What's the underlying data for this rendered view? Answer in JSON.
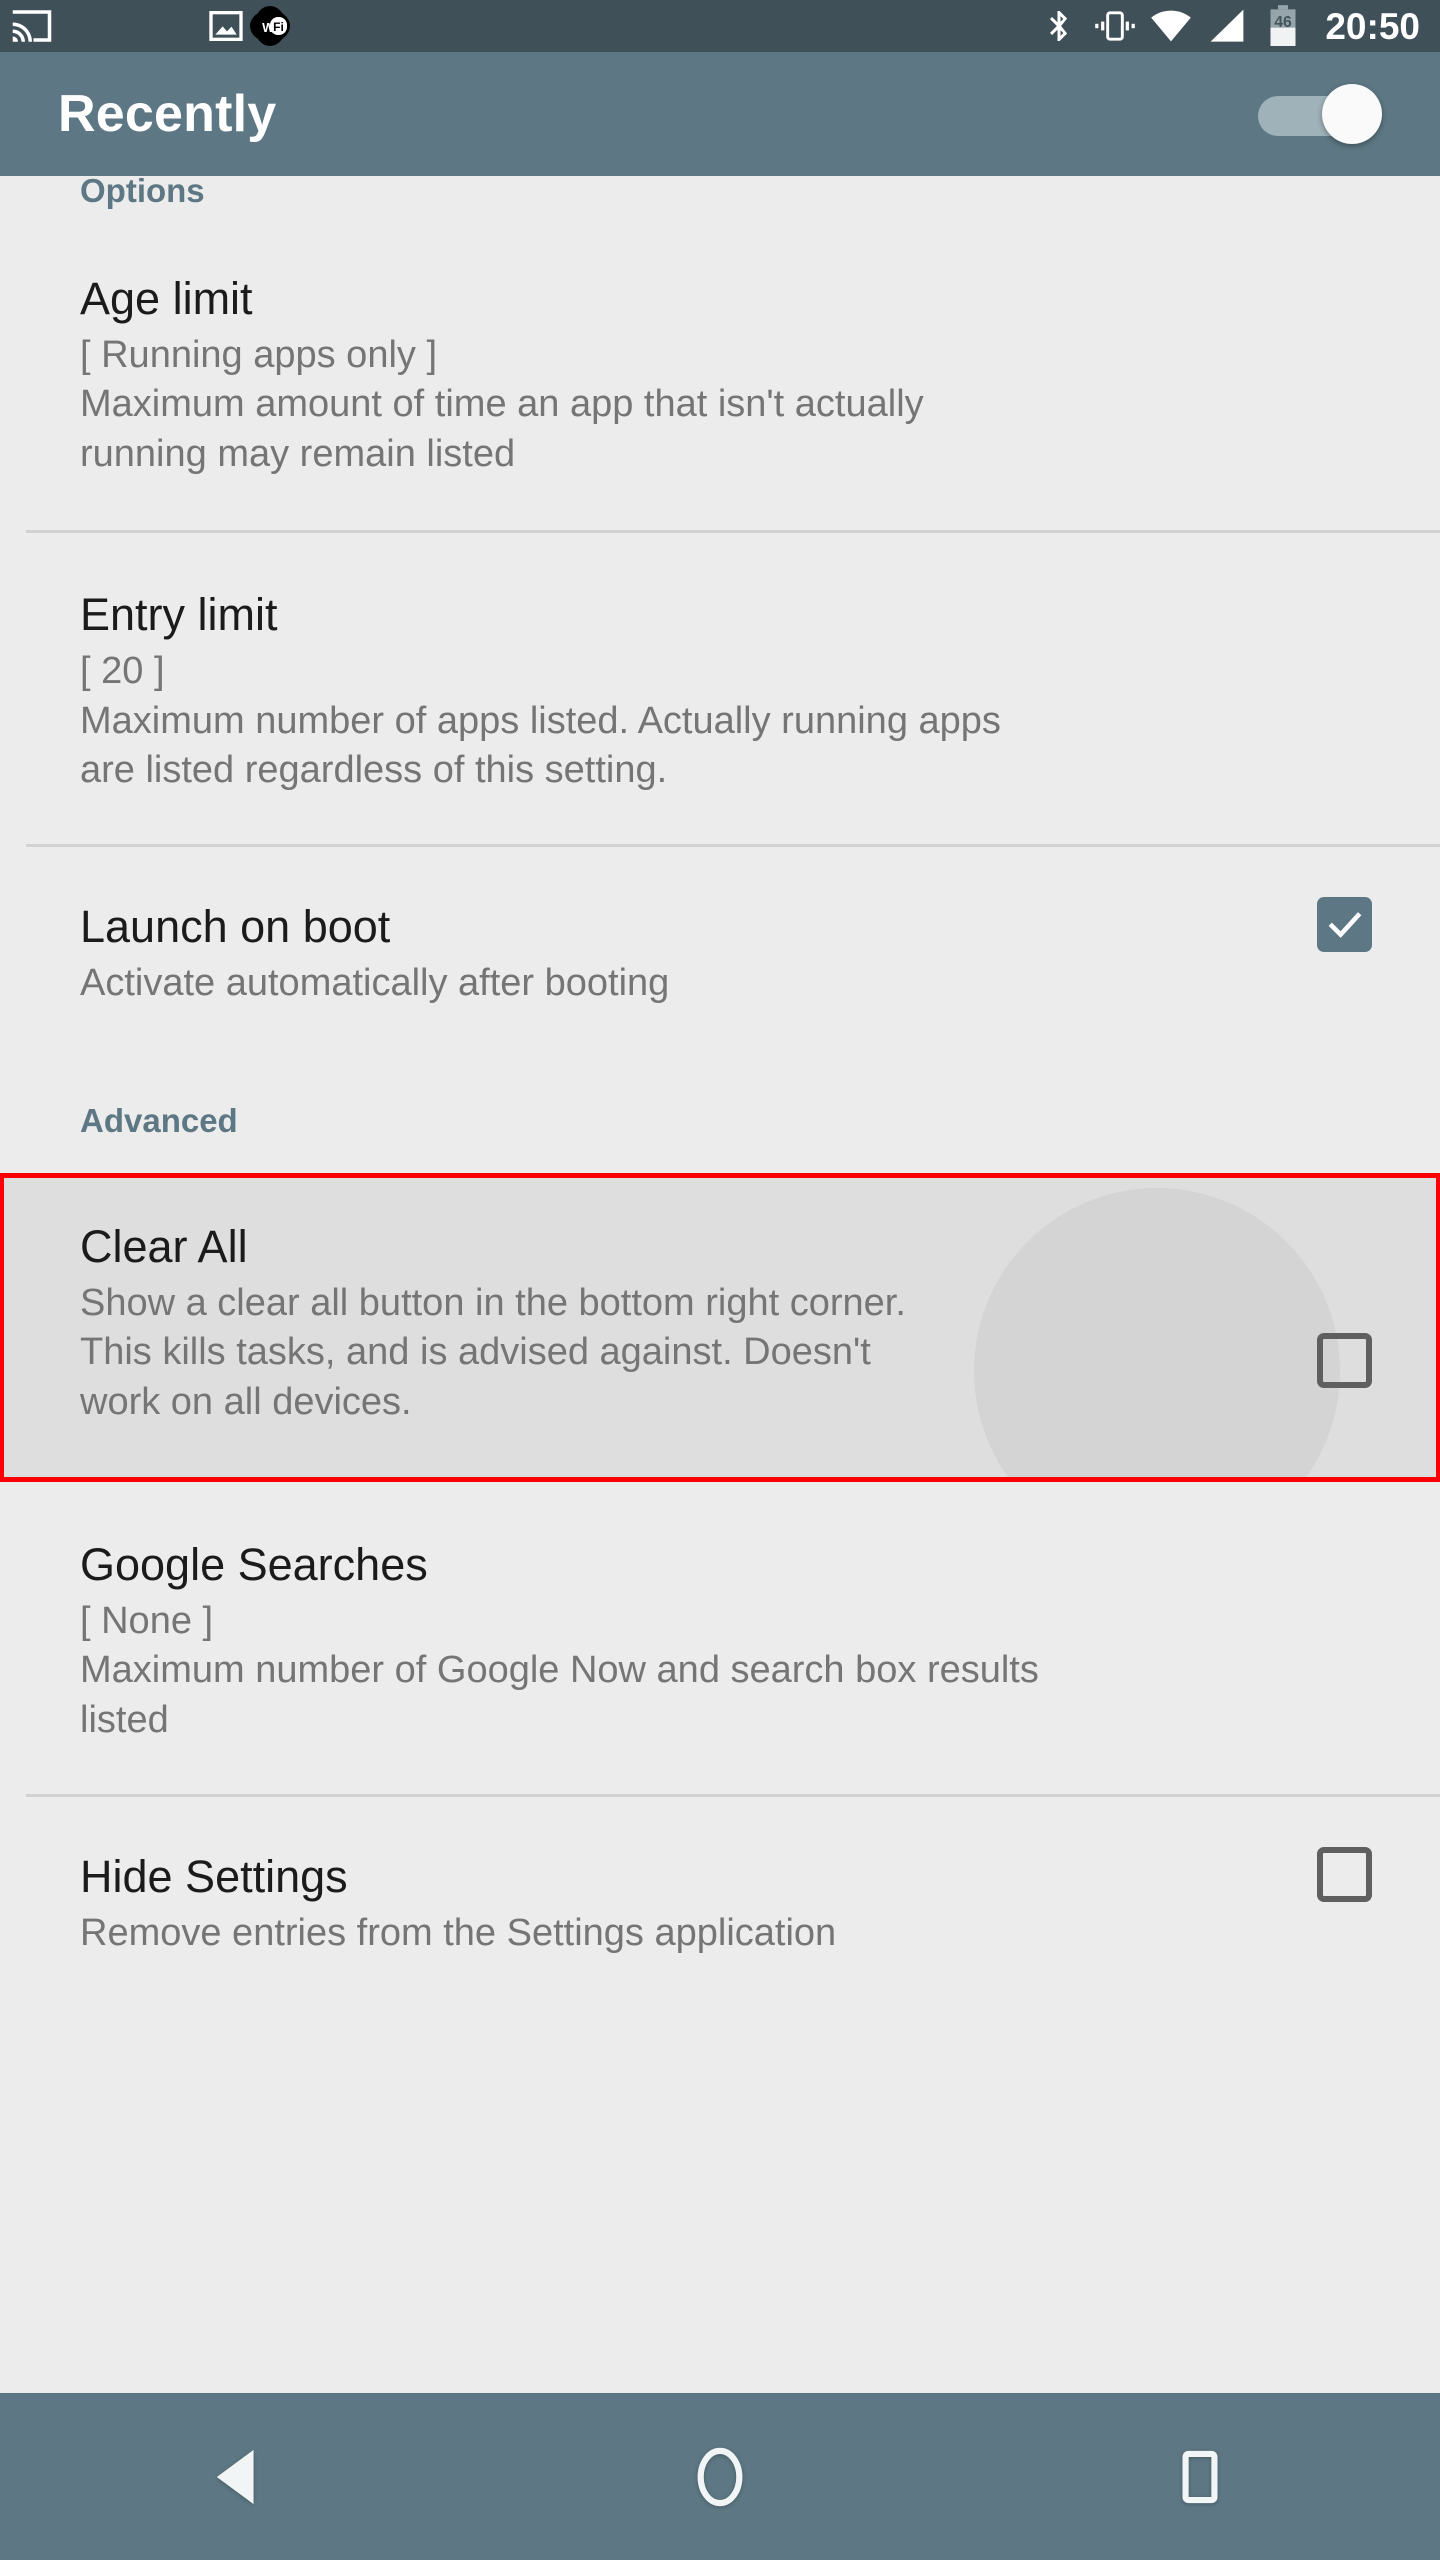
{
  "status_bar": {
    "background_color": "#3f5058",
    "clock": "20:50",
    "battery_level": "46",
    "left_icons": [
      {
        "name": "cast-icon"
      },
      {
        "name": "screenshot-image-icon"
      },
      {
        "name": "wifi-calling-icon",
        "label": "WiFi"
      }
    ],
    "right_icons": [
      {
        "name": "bluetooth-icon"
      },
      {
        "name": "vibrate-mode-icon"
      },
      {
        "name": "wifi-signal-icon"
      },
      {
        "name": "cellular-signal-icon"
      },
      {
        "name": "battery-icon"
      }
    ]
  },
  "app_bar": {
    "title": "Recently",
    "background_color": "#5d7884",
    "master_switch": {
      "state": "on",
      "name": "master-enable-switch"
    }
  },
  "sections": [
    {
      "header": "Options",
      "items": [
        {
          "id": "age-limit",
          "title": "Age limit",
          "summary_lines": [
            "[ Running apps only ]",
            "Maximum amount of time an app that isn't actually",
            "running may remain listed"
          ],
          "control": "none",
          "divider_below": true
        },
        {
          "id": "entry-limit",
          "title": "Entry limit",
          "summary_lines": [
            "[ 20 ]",
            "Maximum number of apps listed. Actually running apps",
            "are listed regardless of this setting."
          ],
          "control": "none",
          "divider_below": true
        },
        {
          "id": "launch-on-boot",
          "title": "Launch on boot",
          "summary_lines": [
            "Activate automatically after booting"
          ],
          "control": "checkbox",
          "checked": true,
          "divider_below": false
        }
      ]
    },
    {
      "header": "Advanced",
      "items": [
        {
          "id": "clear-all",
          "title": "Clear All",
          "summary_lines": [
            "Show a clear all button in the bottom right corner.",
            "This kills tasks, and is advised against. Doesn't",
            "work on all devices."
          ],
          "control": "checkbox",
          "checked": false,
          "highlighted": true,
          "highlight_color": "#fb0007",
          "divider_below": false
        },
        {
          "id": "google-searches",
          "title": "Google Searches",
          "summary_lines": [
            "[ None ]",
            "Maximum number of Google Now and search box results",
            "listed"
          ],
          "control": "none",
          "divider_below": true
        },
        {
          "id": "hide-settings",
          "title": "Hide Settings",
          "summary_lines": [
            "Remove entries from the Settings application"
          ],
          "control": "checkbox",
          "checked": false,
          "divider_below": false
        }
      ]
    }
  ],
  "nav_bar": {
    "background_color": "#5d7884",
    "buttons": [
      {
        "name": "nav-back-button",
        "icon": "back-triangle-icon"
      },
      {
        "name": "nav-home-button",
        "icon": "home-circle-icon"
      },
      {
        "name": "nav-recents-button",
        "icon": "recents-square-icon"
      }
    ]
  },
  "theme": {
    "accent": "#5d7884",
    "page_background": "#ececec",
    "title_text": "#1b1b1b",
    "summary_text": "#757575",
    "divider": "#d2d2d2"
  }
}
